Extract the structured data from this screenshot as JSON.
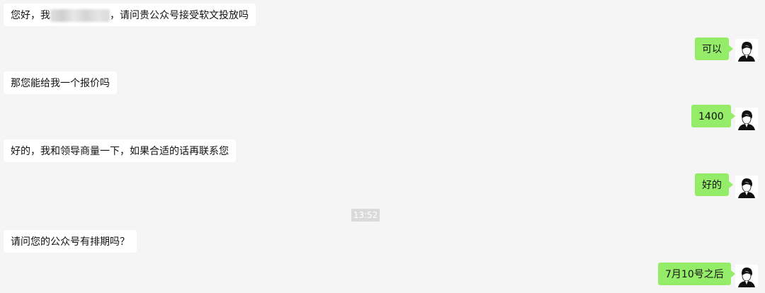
{
  "messages": [
    {
      "side": "in",
      "before": "您好，我",
      "after": "，请问贵公众号接受软文投放吗"
    },
    {
      "side": "out",
      "text": "可以"
    },
    {
      "side": "in",
      "text": "那您能给我一个报价吗"
    },
    {
      "side": "out",
      "text": "1400"
    },
    {
      "side": "in",
      "text": "好的，我和领导商量一下，如果合适的话再联系您"
    },
    {
      "side": "out",
      "text": "好的"
    },
    {
      "side": "in",
      "text": "请问您的公众号有排期吗？"
    },
    {
      "side": "out",
      "text": "7月10号之后"
    }
  ],
  "timestamp": "13:52",
  "avatar_icon": "user-avatar-icon"
}
